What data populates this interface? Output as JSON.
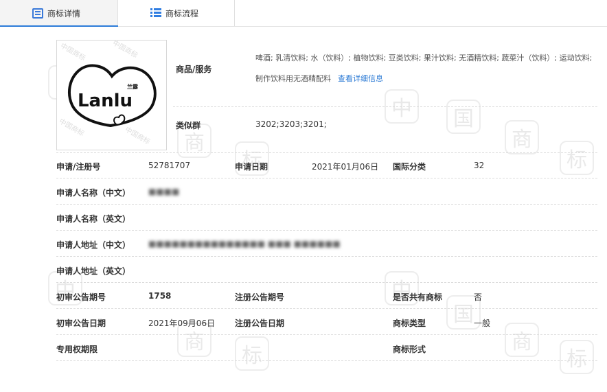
{
  "tabs": [
    {
      "label": "商标详情",
      "icon": "document-icon"
    },
    {
      "label": "商标流程",
      "icon": "list-icon"
    }
  ],
  "logo": {
    "text": "Lanlu",
    "chinese_text": "兰露",
    "watermark": "中国商标"
  },
  "goods_service": {
    "label": "商品/服务",
    "value": "啤酒; 乳清饮料; 水（饮料）; 植物饮料; 豆类饮料; 果汁饮料; 无酒精饮料; 蔬菜汁（饮料）; 运动饮料; 制作饮料用无酒精配料",
    "detail_link": "查看详细信息"
  },
  "similar_group": {
    "label": "类似群",
    "value": "3202;3203;3201;"
  },
  "fields": {
    "reg_no_label": "申请/注册号",
    "reg_no": "52781707",
    "app_date_label": "申请日期",
    "app_date": "2021年01月06日",
    "intl_class_label": "国际分类",
    "intl_class": "32",
    "applicant_cn_label": "申请人名称（中文）",
    "applicant_cn": "■■■■",
    "applicant_en_label": "申请人名称（英文）",
    "address_cn_label": "申请人地址（中文）",
    "address_cn": "■■■■■■■■■■■■■■■ ■■■ ■■■■■■",
    "address_en_label": "申请人地址（英文）",
    "prelim_issue_label": "初审公告期号",
    "prelim_issue": "1758",
    "reg_issue_label": "注册公告期号",
    "shared_label": "是否共有商标",
    "shared": "否",
    "prelim_date_label": "初审公告日期",
    "prelim_date": "2021年09月06日",
    "reg_date_label": "注册公告日期",
    "mark_type_label": "商标类型",
    "mark_type": "一般",
    "exclusive_period_label": "专用权期限",
    "mark_form_label": "商标形式"
  },
  "background_watermark": [
    "中",
    "国",
    "商",
    "标"
  ]
}
